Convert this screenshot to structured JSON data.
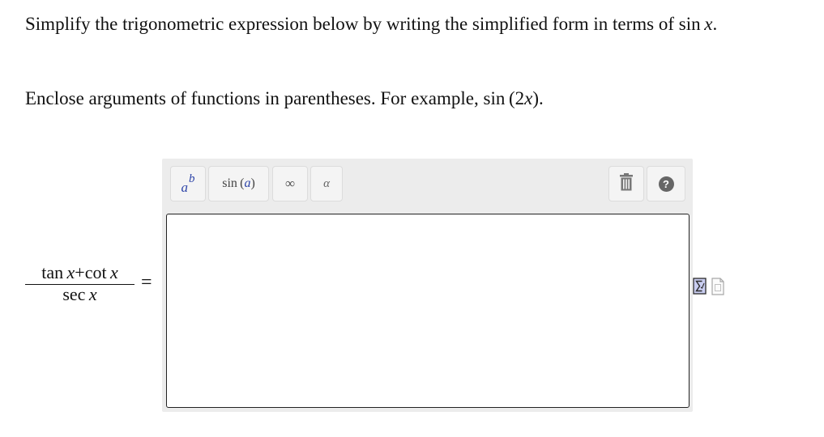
{
  "instructions": {
    "line1_text": "Simplify the trigonometric expression below by writing the simplified form in terms of ",
    "line1_func": "sin",
    "line1_var": "x",
    "line1_end": ".",
    "line2_text": "Enclose arguments of functions in parentheses. For example, ",
    "line2_func": "sin",
    "line2_open": "(2",
    "line2_var": "x",
    "line2_close": ")",
    "line2_end": "."
  },
  "expression": {
    "num_tan": "tan",
    "num_x1": "x",
    "num_plus": "+",
    "num_cot": "cot",
    "num_x2": "x",
    "den_sec": "sec",
    "den_x": "x",
    "equals": "="
  },
  "toolbar": {
    "power_base": "a",
    "power_exp": "b",
    "trig_func": "sin",
    "trig_open": "(",
    "trig_arg": "a",
    "trig_close": ")",
    "infinity": "∞",
    "greek": "α",
    "help": "?"
  },
  "answer": {
    "value": ""
  },
  "icons": {
    "power": "superscript-icon",
    "trash": "trash-icon",
    "help": "help-icon",
    "formula": "formula-preview-icon",
    "document": "document-icon"
  },
  "colors": {
    "accent_blue": "#2e45a8",
    "toolbar_bg": "#ececec",
    "button_bg": "#f4f4f4"
  }
}
